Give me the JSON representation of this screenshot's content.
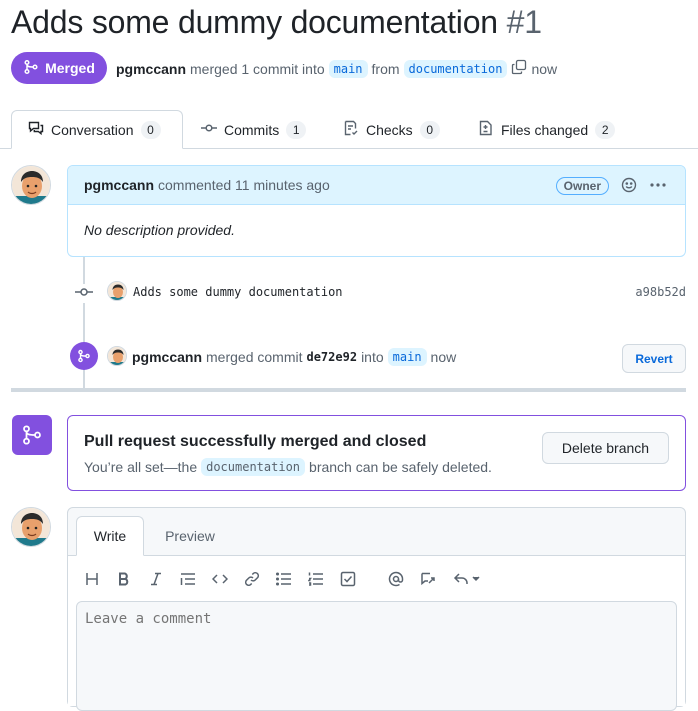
{
  "pr": {
    "title": "Adds some dummy documentation",
    "number": "#1",
    "state": "Merged",
    "author": "pgmccann",
    "merged_text": "merged 1 commit into",
    "base_branch": "main",
    "from_text": "from",
    "head_branch": "documentation",
    "time": "now"
  },
  "tabs": [
    {
      "label": "Conversation",
      "count": "0"
    },
    {
      "label": "Commits",
      "count": "1"
    },
    {
      "label": "Checks",
      "count": "0"
    },
    {
      "label": "Files changed",
      "count": "2"
    }
  ],
  "comment": {
    "author": "pgmccann",
    "action": "commented 11 minutes ago",
    "badge": "Owner",
    "body": "No description provided."
  },
  "commit": {
    "message": "Adds some dummy documentation",
    "sha": "a98b52d"
  },
  "merge_event": {
    "author": "pgmccann",
    "text1": "merged commit",
    "sha": "de72e92",
    "text2": "into",
    "branch": "main",
    "time": "now",
    "revert_label": "Revert"
  },
  "merged_box": {
    "title": "Pull request successfully merged and closed",
    "sub_before": "You’re all set—the",
    "branch": "documentation",
    "sub_after": "branch can be safely deleted.",
    "delete_label": "Delete branch"
  },
  "editor": {
    "tab_write": "Write",
    "tab_preview": "Preview",
    "placeholder": "Leave a comment"
  },
  "colors": {
    "merged_purple": "#8250df",
    "link_blue": "#0969da",
    "comment_header_bg": "#ddf4ff"
  }
}
